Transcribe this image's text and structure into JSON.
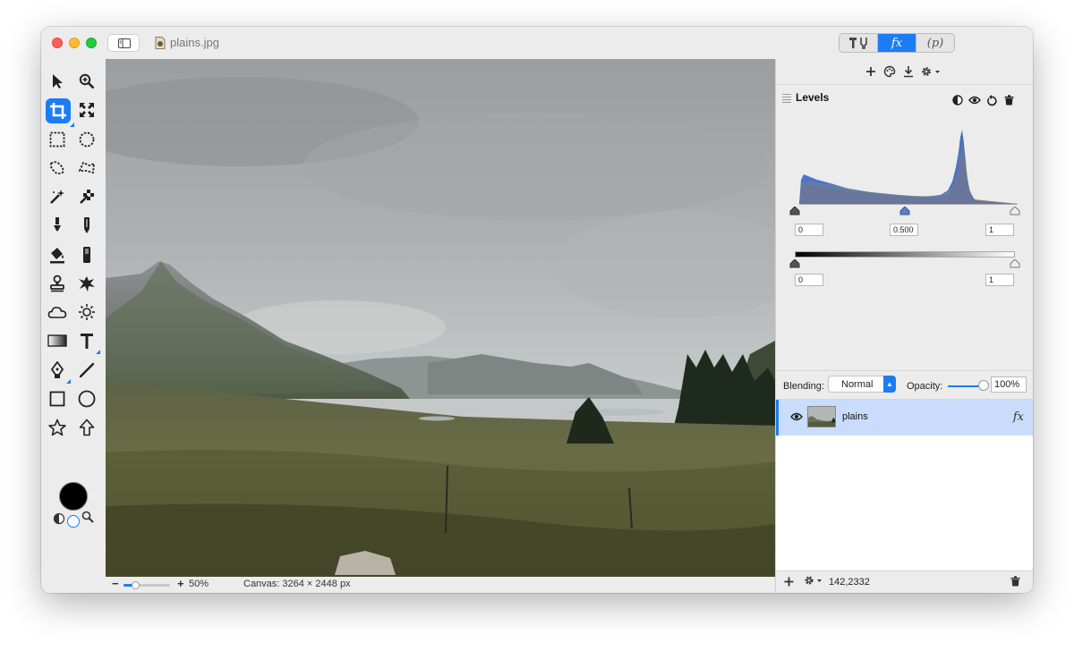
{
  "window": {
    "title": "plains.jpg"
  },
  "mode_tabs": [
    {
      "name": "tools-icon"
    },
    {
      "label": "fx",
      "active": true
    },
    {
      "label": "(p)"
    }
  ],
  "filter_toolbar": {
    "icons": [
      "plus-icon",
      "palette-icon",
      "download-icon",
      "gear-dropdown-icon"
    ]
  },
  "levels": {
    "title": "Levels",
    "input_black": "0",
    "input_gamma": "0.500",
    "input_white": "1",
    "output_black": "0",
    "output_white": "1",
    "icons": [
      "half-circle-icon",
      "eye-icon",
      "reset-icon",
      "trash-icon"
    ]
  },
  "blending": {
    "label": "Blending:",
    "mode": "Normal",
    "opacity_label": "Opacity:",
    "opacity_value": "100%",
    "opacity_fraction": 1.0
  },
  "layers": [
    {
      "name": "plains",
      "fx": "fx",
      "selected": true,
      "visible": true
    }
  ],
  "layers_footer": {
    "coords": "142,2332"
  },
  "status": {
    "zoom_minus": "−",
    "zoom_plus": "+",
    "zoom": "50%",
    "zoom_fraction": 0.25,
    "canvas_info": "Canvas: 3264 × 2448 px"
  },
  "colors": {
    "accent": "#1c7cf4",
    "foreground": "#000000",
    "background": "#ffffff"
  }
}
